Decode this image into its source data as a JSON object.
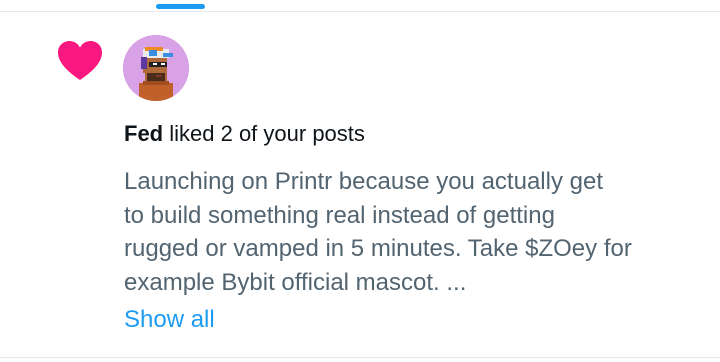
{
  "notification": {
    "actor_name": "Fed",
    "action_text": " liked 2 of your posts",
    "post_preview_lines": [
      "Launching on Printr because you actually get",
      "to build something real instead of getting",
      "rugged or vamped in 5 minutes. Take $ZOey for",
      "example  Bybit official mascot. ..."
    ],
    "show_all_label": "Show all",
    "icon": "heart-icon"
  },
  "colors": {
    "heart": "#f91880",
    "accent": "#1d9bf0",
    "primary_text": "#0f1419",
    "secondary_text": "#536471",
    "avatar_bg": "#d9a2e6"
  }
}
